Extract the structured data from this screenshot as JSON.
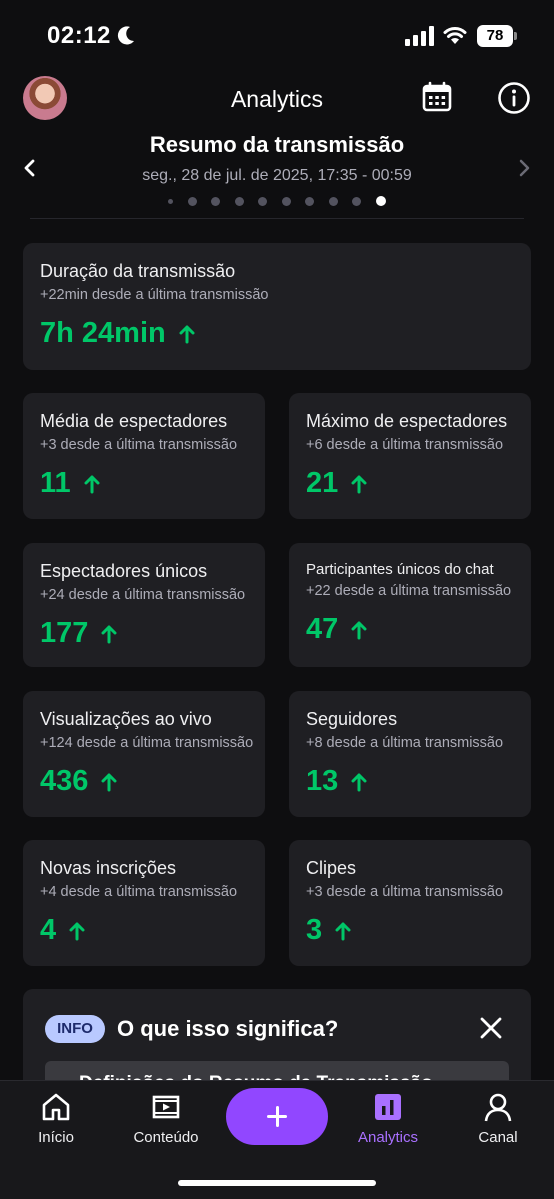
{
  "status_bar": {
    "time": "02:12",
    "battery": "78"
  },
  "header": {
    "title": "Analytics"
  },
  "summary": {
    "title": "Resumo da transmissão",
    "date": "seg., 28 de jul. de 2025, 17:35 - 00:59",
    "page_count": 10,
    "active_page": 10
  },
  "cards": [
    {
      "title": "Duração da transmissão",
      "sub": "+22min desde a última transmissão",
      "value": "7h 24min",
      "trend": "up"
    },
    {
      "title": "Média de espectadores",
      "sub": "+3 desde a última transmissão",
      "value": "11",
      "trend": "up"
    },
    {
      "title": "Máximo de espectadores",
      "sub": "+6 desde a última transmissão",
      "value": "21",
      "trend": "up"
    },
    {
      "title": "Espectadores únicos",
      "sub": "+24 desde a última transmissão",
      "value": "177",
      "trend": "up"
    },
    {
      "title": "Participantes únicos do chat",
      "sub": "+22 desde a última transmissão",
      "value": "47",
      "trend": "up"
    },
    {
      "title": "Visualizações ao vivo",
      "sub": "+124 desde a última transmissão",
      "value": "436",
      "trend": "up"
    },
    {
      "title": "Seguidores",
      "sub": "+8 desde a última transmissão",
      "value": "13",
      "trend": "up"
    },
    {
      "title": "Novas inscrições",
      "sub": "+4 desde a última transmissão",
      "value": "4",
      "trend": "up"
    },
    {
      "title": "Clipes",
      "sub": "+3 desde a última transmissão",
      "value": "3",
      "trend": "up"
    }
  ],
  "info": {
    "badge": "INFO",
    "title": "O que isso significa?",
    "inner_label": "Definições do Resumo da Transmissão"
  },
  "bottom_nav": [
    {
      "label": "Início",
      "icon": "home-icon"
    },
    {
      "label": "Conteúdo",
      "icon": "content-icon"
    },
    {
      "label": "Analytics",
      "icon": "analytics-icon",
      "active": true
    },
    {
      "label": "Canal",
      "icon": "profile-icon"
    }
  ],
  "colors": {
    "accent": "#9147ff",
    "positive": "#00c768",
    "card": "#1f1f23",
    "background": "#0e0e10"
  }
}
